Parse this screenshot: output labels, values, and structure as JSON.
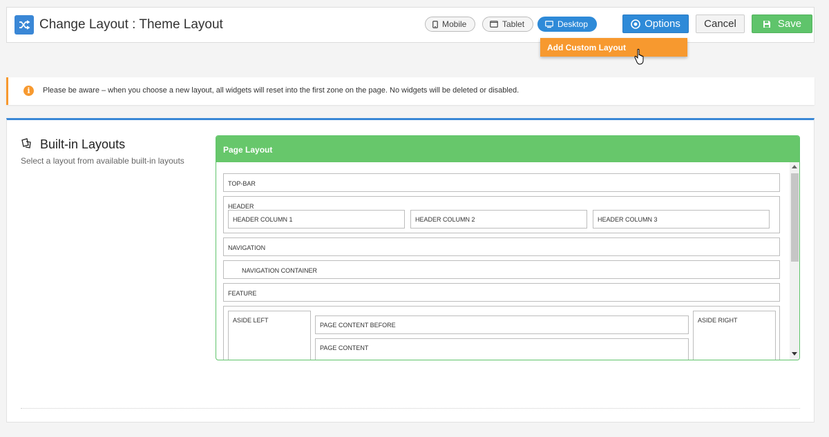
{
  "header": {
    "title": "Change Layout : Theme Layout",
    "devices": [
      {
        "label": "Mobile",
        "icon": "mobile-icon",
        "active": false
      },
      {
        "label": "Tablet",
        "icon": "tablet-icon",
        "active": false
      },
      {
        "label": "Desktop",
        "icon": "desktop-icon",
        "active": true
      }
    ],
    "options_label": "Options",
    "cancel_label": "Cancel",
    "save_label": "Save"
  },
  "dropdown": {
    "items": [
      "Add Custom Layout"
    ]
  },
  "alert": {
    "text": "Please be aware – when you choose a new layout, all widgets will reset into the first zone on the page. No widgets will be deleted or disabled."
  },
  "section": {
    "title": "Built-in Layouts",
    "subtitle": "Select a layout from available built-in layouts"
  },
  "layout": {
    "panel_title": "Page Layout",
    "zones": {
      "top_bar": "TOP-BAR",
      "header": "HEADER",
      "header_col_1": "HEADER COLUMN 1",
      "header_col_2": "HEADER COLUMN 2",
      "header_col_3": "HEADER COLUMN 3",
      "navigation": "NAVIGATION",
      "navigation_container": "NAVIGATION CONTAINER",
      "feature": "FEATURE",
      "aside_left": "ASIDE LEFT",
      "page_content_before": "PAGE CONTENT BEFORE",
      "page_content": "PAGE CONTENT",
      "aside_right": "ASIDE RIGHT"
    }
  },
  "colors": {
    "primary": "#2e8ad8",
    "success": "#5fc46b",
    "warning": "#f7992f"
  }
}
